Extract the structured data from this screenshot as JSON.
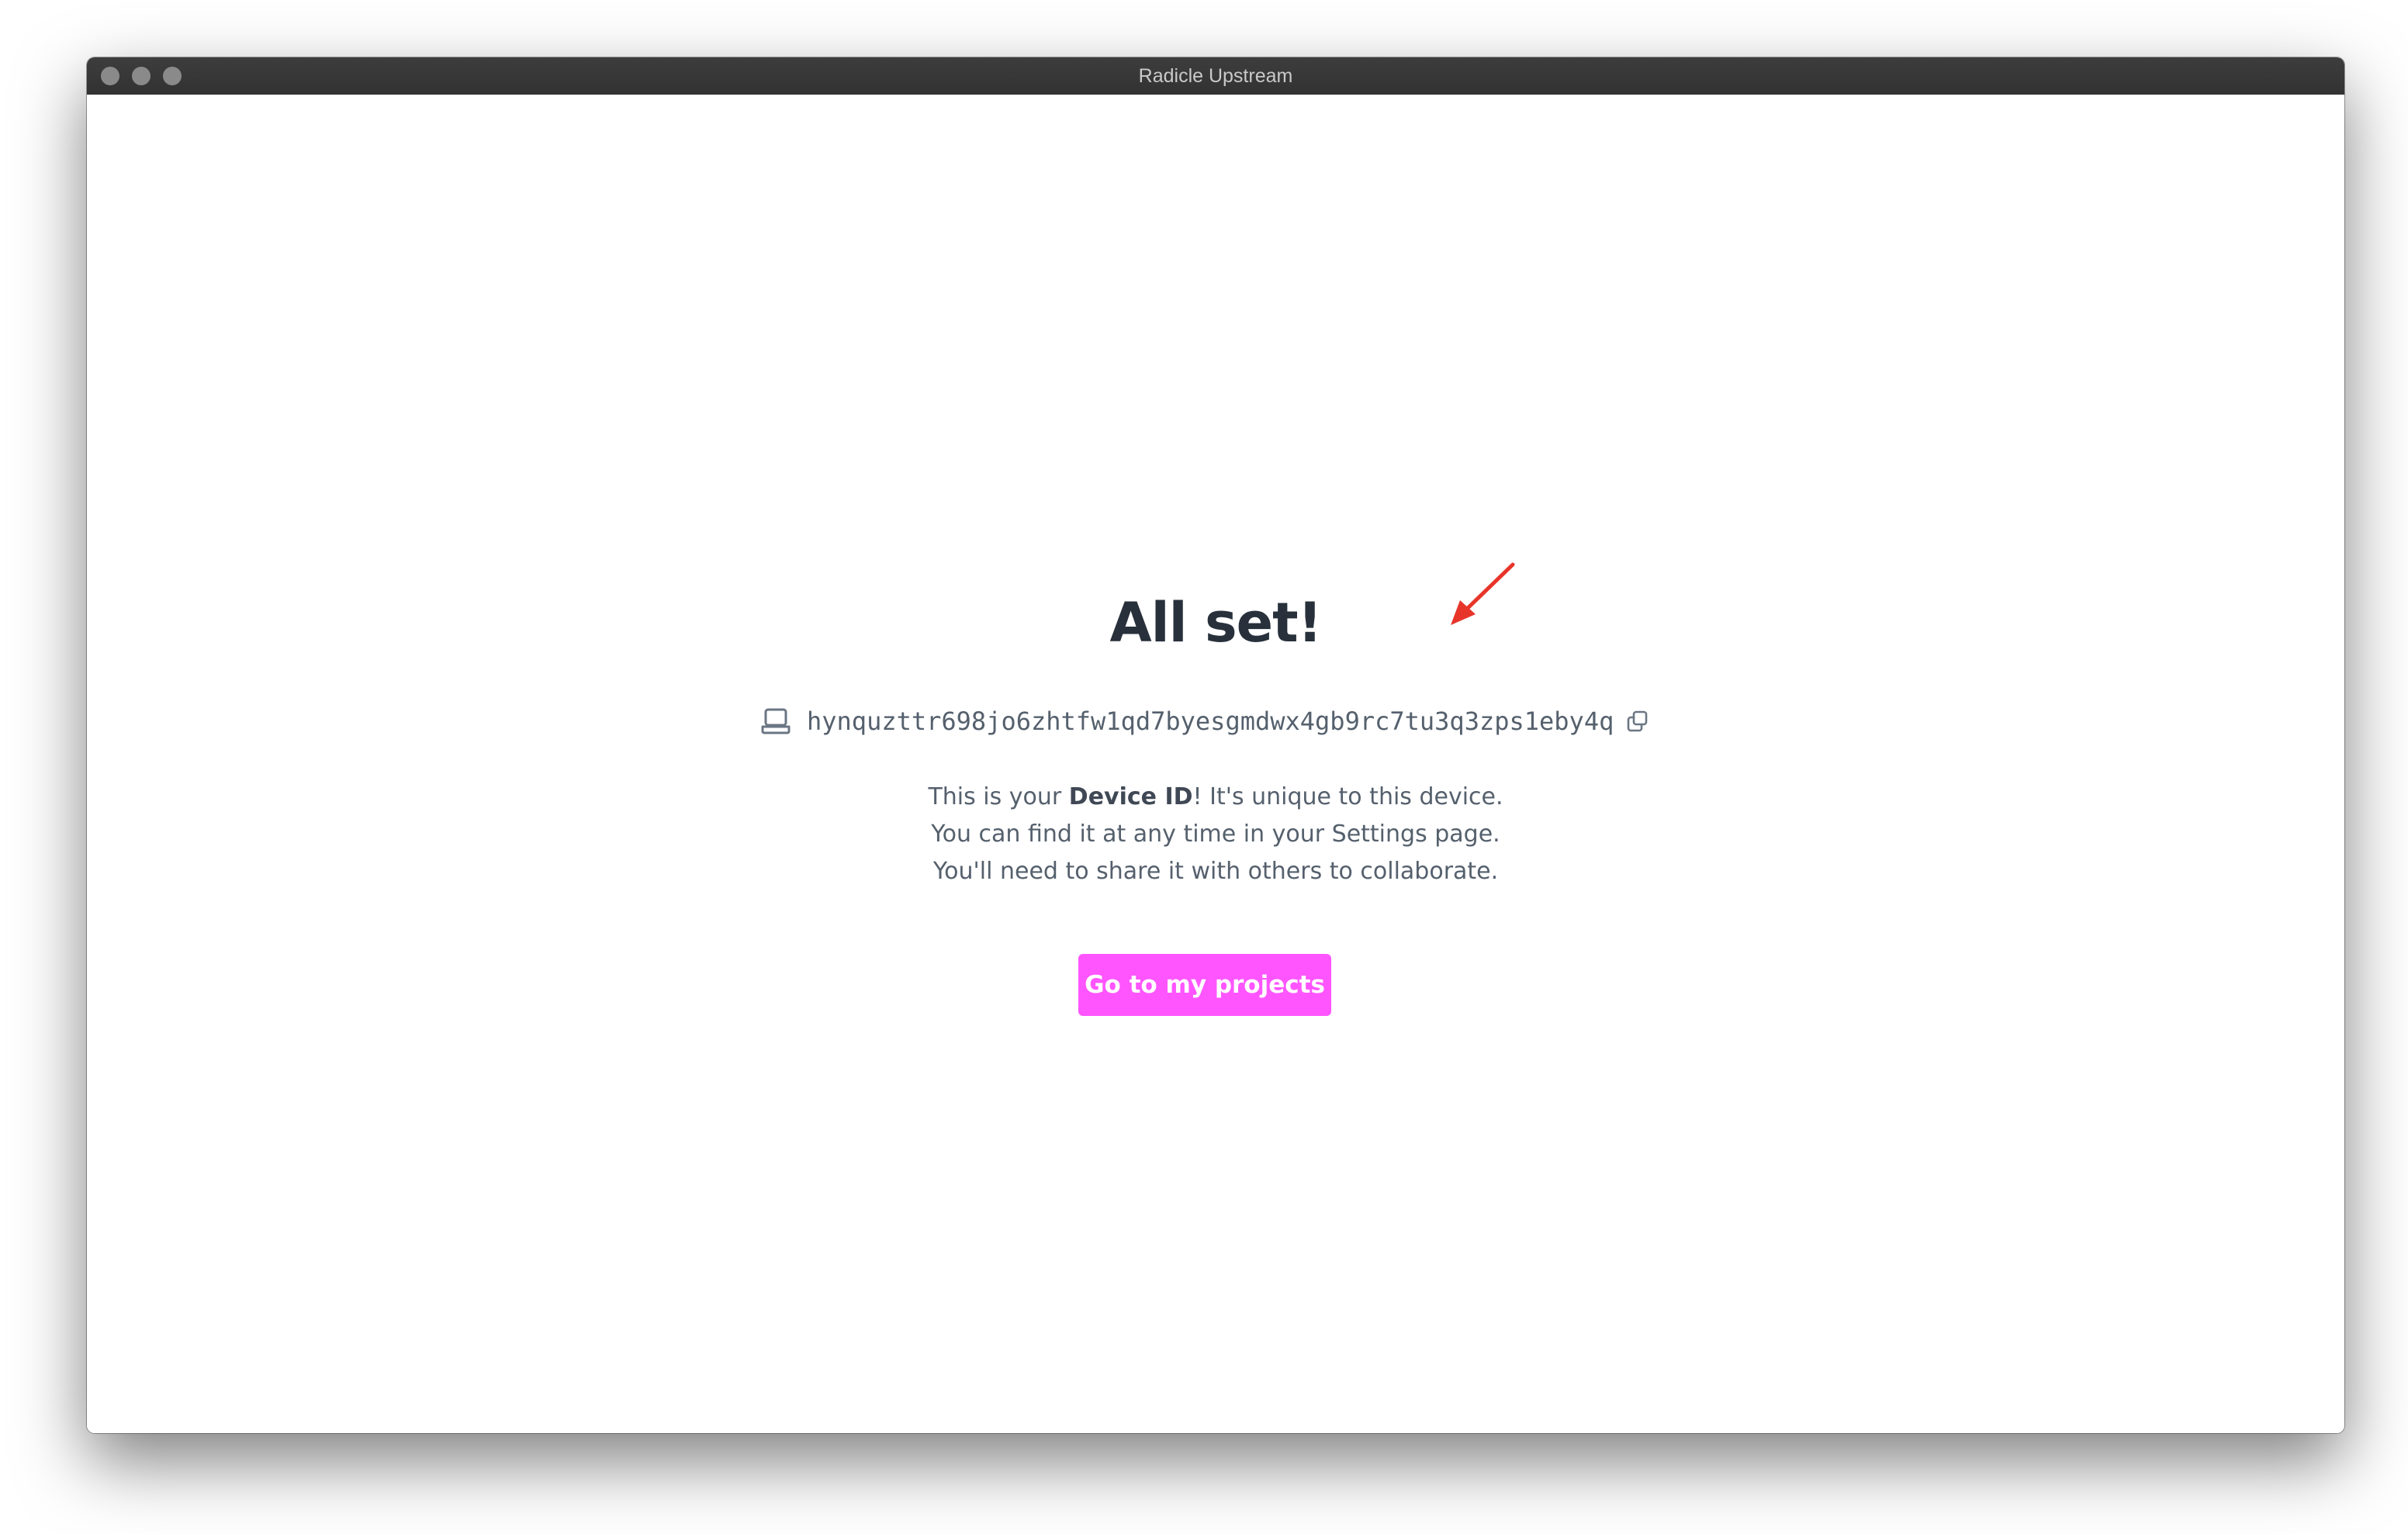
{
  "window": {
    "title": "Radicle Upstream"
  },
  "main": {
    "heading": "All set!",
    "device_id": "hynquzttr698jo6zhtfw1qd7byesgmdwx4gb9rc7tu3q3zps1eby4q",
    "description": {
      "line1_before": "This is your ",
      "line1_bold": "Device ID",
      "line1_after": "! It's unique to this device.",
      "line2": "You can find it at any time in your Settings page.",
      "line3": "You'll need to share it with others to collaborate."
    },
    "cta_label": "Go to my projects"
  },
  "icons": {
    "device": "laptop-icon",
    "copy": "copy-icon",
    "annotation": "red-arrow-icon"
  },
  "colors": {
    "accent": "#ff55ff",
    "heading": "#27303b",
    "body_text": "#55606d",
    "annotation_arrow": "#e8352a"
  }
}
